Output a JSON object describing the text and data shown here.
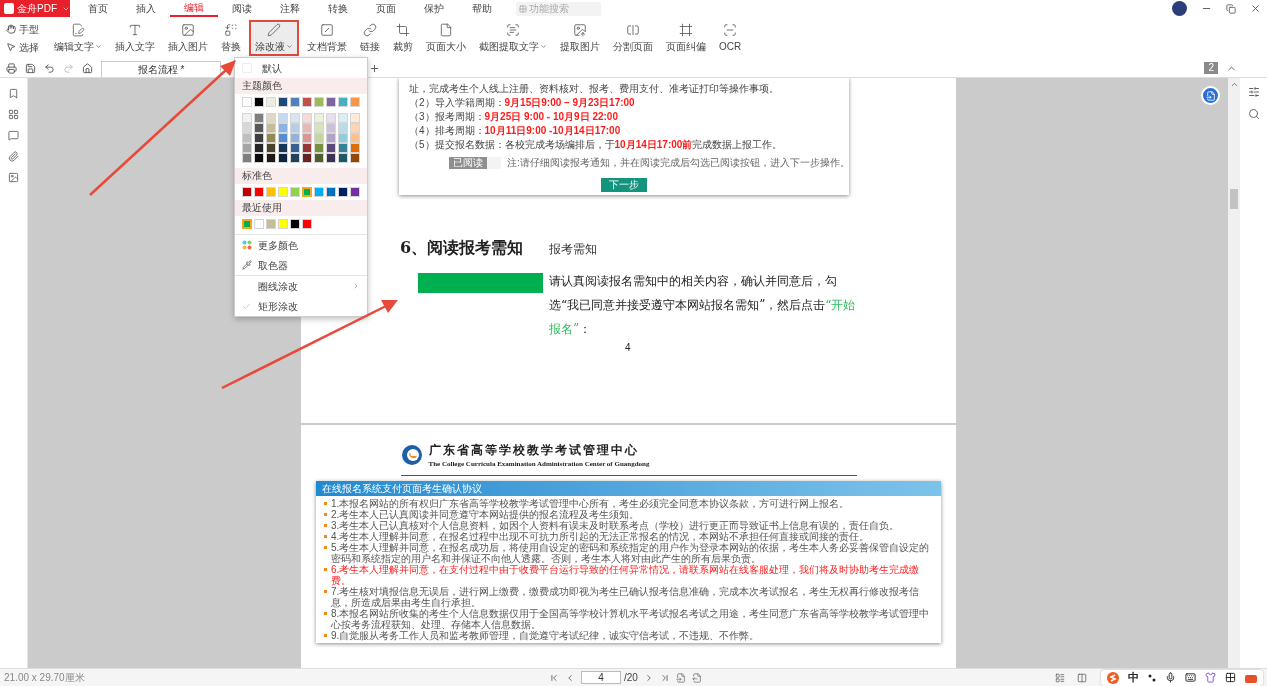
{
  "app": {
    "logo": "金舟PDF",
    "search": {
      "placeholder": "功能搜索"
    }
  },
  "menu": {
    "tabs": [
      {
        "label": "首页",
        "selected": false
      },
      {
        "label": "插入",
        "selected": false
      },
      {
        "label": "编辑",
        "selected": true
      },
      {
        "label": "阅读",
        "selected": false
      },
      {
        "label": "注释",
        "selected": false
      },
      {
        "label": "转换",
        "selected": false
      },
      {
        "label": "页面",
        "selected": false
      },
      {
        "label": "保护",
        "selected": false
      },
      {
        "label": "帮助",
        "selected": false
      }
    ]
  },
  "ribbon": {
    "modes": [
      {
        "label": "手型"
      },
      {
        "label": "选择"
      }
    ],
    "tools": [
      {
        "label": "编辑文字",
        "dropdown": true,
        "selected": false
      },
      {
        "label": "插入文字",
        "dropdown": false,
        "selected": false
      },
      {
        "label": "插入图片",
        "dropdown": false,
        "selected": false
      },
      {
        "label": "替换",
        "dropdown": false,
        "selected": false
      },
      {
        "label": "涂改液",
        "dropdown": true,
        "selected": true
      },
      {
        "label": "文档背景",
        "dropdown": false,
        "selected": false
      },
      {
        "label": "链接",
        "dropdown": false,
        "selected": false
      },
      {
        "label": "裁剪",
        "dropdown": false,
        "selected": false
      },
      {
        "label": "页面大小",
        "dropdown": false,
        "selected": false
      },
      {
        "label": "截图提取文字",
        "dropdown": true,
        "selected": false
      },
      {
        "label": "提取图片",
        "dropdown": false,
        "selected": false
      },
      {
        "label": "分割页面",
        "dropdown": false,
        "selected": false
      },
      {
        "label": "页面纠偏",
        "dropdown": false,
        "selected": false
      },
      {
        "label": "OCR",
        "dropdown": false,
        "selected": false
      }
    ]
  },
  "doc_tabs": [
    {
      "label": "报名流程 *",
      "selected": true
    }
  ],
  "page_badge": "2",
  "page1": {
    "notice": {
      "lines": [
        {
          "segments": [
            {
              "text": "址，完成考生个人线上注册、资料核对、报考、费用支付、准考证打印等操作事项。",
              "emphasis": false
            }
          ]
        },
        {
          "segments": [
            {
              "text": "（2）导入学籍周期：",
              "emphasis": false
            },
            {
              "text": "9月15日9:00 – 9月23日17:00",
              "emphasis": true
            }
          ]
        },
        {
          "segments": [
            {
              "text": "（3）报考周期：",
              "emphasis": false
            },
            {
              "text": "9月25日 9:00 - 10月9日 22:00",
              "emphasis": true
            }
          ]
        },
        {
          "segments": [
            {
              "text": "（4）排考周期：",
              "emphasis": false
            },
            {
              "text": "10月11日9:00 -10月14日17:00",
              "emphasis": true
            }
          ]
        },
        {
          "segments": [
            {
              "text": "（5）提交报名数据：各校完成考场编排后，于",
              "emphasis": false
            },
            {
              "text": "10月14日17:00前",
              "emphasis": true
            },
            {
              "text": "完成数据上报工作。",
              "emphasis": false
            }
          ]
        }
      ],
      "read_toggle": "已阅读",
      "note": "注:请仔细阅读报考通知，并在阅读完成后勾选已阅读按钮，进入下一步操作。",
      "next_button": "下一步"
    },
    "heading": "6、阅读报考需知",
    "heading_aside": "报考需知",
    "paragraph": [
      {
        "text": "请认真阅读报名需知中的相关内容，确认并同意后，勾选“我已同意并接受遵守本网站报名需知”，然后点击",
        "emphasis": false
      },
      {
        "text": "“开始报名”",
        "emphasis": true
      },
      {
        "text": "：",
        "emphasis": false
      }
    ],
    "page_number": "4"
  },
  "page2": {
    "org_name": "广东省高等学校教学考试管理中心",
    "org_name_en": "The College Curricula Examination Administration Center of Guangdong",
    "panel_title": "在线报名系统支付页面考生确认协议",
    "items": [
      {
        "text": "1.本报名网站的所有权归广东省高等学校教学考试管理中心所有，考生必须完全同意本协议条款，方可进行网上报名。",
        "emphasis": false
      },
      {
        "text": "2.考生本人已认真阅读并同意遵守本网站提供的报名流程及考生须知。",
        "emphasis": false
      },
      {
        "text": "3.考生本人已认真核对个人信息资料，如因个人资料有误未及时联系考点（学校）进行更正而导致证书上信息有误的，责任自负。",
        "emphasis": false
      },
      {
        "text": "4.考生本人理解并同意，在报名过程中出现不可抗力所引起的无法正常报名的情况，本网站不承担任何直接或间接的责任。",
        "emphasis": false
      },
      {
        "text": "5.考生本人理解并同意，在报名成功后，将使用自设定的密码和系统指定的用户作为登录本网站的依据，考生本人务必妥善保管自设定的密码和系统指定的用户名和并保证不向他人透露。否则，考生本人将对由此产生的所有后果负责。",
        "emphasis": false
      },
      {
        "text": "6.考生本人理解并同意，在支付过程中由于收费平台运行导致的任何异常情况，请联系网站在线客服处理，我们将及时协助考生完成缴费。",
        "emphasis": true
      },
      {
        "text": "7.考生核对填报信息无误后，进行网上缴费，缴费成功即视为考生已确认报考信息准确，完成本次考试报名，考生无权再行修改报考信息，所造成后果由考生自行承担。",
        "emphasis": false
      },
      {
        "text": "8.本报名网站所收集的考生个人信息数据仅用于全国高等学校计算机水平考试报名考试之用途，考生同意广东省高等学校教学考试管理中心按考务流程获知、处理、存储本人信息数据。",
        "emphasis": false
      },
      {
        "text": "9.自觉服从考务工作人员和监考教师管理，自觉遵守考试纪律，诚实守信考试，不违规、不作弊。",
        "emphasis": false
      }
    ]
  },
  "color_menu": {
    "default_label": "默认",
    "theme_title": "主题颜色",
    "theme_colors": [
      {
        "color": "#ffffff",
        "selected": false
      },
      {
        "color": "#000000",
        "selected": false
      },
      {
        "color": "#eeece1",
        "selected": false
      },
      {
        "color": "#1f497d",
        "selected": false
      },
      {
        "color": "#4f81bd",
        "selected": false
      },
      {
        "color": "#c0504d",
        "selected": false
      },
      {
        "color": "#9bbb59",
        "selected": false
      },
      {
        "color": "#8064a2",
        "selected": false
      },
      {
        "color": "#4bacc6",
        "selected": false
      },
      {
        "color": "#f79646",
        "selected": false
      }
    ],
    "theme_shades": [
      {
        "color": "#f2f2f2",
        "selected": false
      },
      {
        "color": "#7f7f7f",
        "selected": false
      },
      {
        "color": "#ddd9c3",
        "selected": false
      },
      {
        "color": "#c6d9f0",
        "selected": false
      },
      {
        "color": "#dbe5f1",
        "selected": false
      },
      {
        "color": "#f2dcdb",
        "selected": false
      },
      {
        "color": "#ebf1dd",
        "selected": false
      },
      {
        "color": "#e5e0ec",
        "selected": false
      },
      {
        "color": "#dbeef3",
        "selected": false
      },
      {
        "color": "#fdeada",
        "selected": false
      },
      {
        "color": "#d8d8d8",
        "selected": false
      },
      {
        "color": "#595959",
        "selected": false
      },
      {
        "color": "#c4bd97",
        "selected": false
      },
      {
        "color": "#8db3e2",
        "selected": false
      },
      {
        "color": "#b8cce4",
        "selected": false
      },
      {
        "color": "#e5b9b7",
        "selected": false
      },
      {
        "color": "#d7e3bc",
        "selected": false
      },
      {
        "color": "#ccc1d9",
        "selected": false
      },
      {
        "color": "#b7dde8",
        "selected": false
      },
      {
        "color": "#fbd5b5",
        "selected": false
      },
      {
        "color": "#bfbfbf",
        "selected": false
      },
      {
        "color": "#3f3f3f",
        "selected": false
      },
      {
        "color": "#938953",
        "selected": false
      },
      {
        "color": "#548dd4",
        "selected": false
      },
      {
        "color": "#95b3d7",
        "selected": false
      },
      {
        "color": "#d99694",
        "selected": false
      },
      {
        "color": "#c3d69b",
        "selected": false
      },
      {
        "color": "#b2a2c7",
        "selected": false
      },
      {
        "color": "#92cddc",
        "selected": false
      },
      {
        "color": "#fac08f",
        "selected": false
      },
      {
        "color": "#a5a5a5",
        "selected": false
      },
      {
        "color": "#262626",
        "selected": false
      },
      {
        "color": "#494429",
        "selected": false
      },
      {
        "color": "#17365d",
        "selected": false
      },
      {
        "color": "#366092",
        "selected": false
      },
      {
        "color": "#953734",
        "selected": false
      },
      {
        "color": "#76923c",
        "selected": false
      },
      {
        "color": "#5f497a",
        "selected": false
      },
      {
        "color": "#31859b",
        "selected": false
      },
      {
        "color": "#e36c09",
        "selected": false
      },
      {
        "color": "#7f7f7f",
        "selected": false
      },
      {
        "color": "#0c0c0c",
        "selected": false
      },
      {
        "color": "#1d1b10",
        "selected": false
      },
      {
        "color": "#0f243e",
        "selected": false
      },
      {
        "color": "#244061",
        "selected": false
      },
      {
        "color": "#632423",
        "selected": false
      },
      {
        "color": "#4f6128",
        "selected": false
      },
      {
        "color": "#3f3151",
        "selected": false
      },
      {
        "color": "#205867",
        "selected": false
      },
      {
        "color": "#974806",
        "selected": false
      }
    ],
    "standard_title": "标准色",
    "standard_colors": [
      {
        "color": "#c00000",
        "selected": false
      },
      {
        "color": "#ff0000",
        "selected": false
      },
      {
        "color": "#ffc000",
        "selected": false
      },
      {
        "color": "#ffff00",
        "selected": false
      },
      {
        "color": "#92d050",
        "selected": false
      },
      {
        "color": "#00b050",
        "selected": true
      },
      {
        "color": "#00b0f0",
        "selected": false
      },
      {
        "color": "#0070c0",
        "selected": false
      },
      {
        "color": "#002060",
        "selected": false
      },
      {
        "color": "#7030a0",
        "selected": false
      }
    ],
    "recent_title": "最近使用",
    "recent_colors": [
      {
        "color": "#00b050",
        "selected": true
      },
      {
        "color": "#ffffff",
        "selected": false
      },
      {
        "color": "#c4bd97",
        "selected": false
      },
      {
        "color": "#ffff00",
        "selected": false
      },
      {
        "color": "#000000",
        "selected": false
      },
      {
        "color": "#ff0000",
        "selected": false
      }
    ],
    "actions": [
      {
        "label": "更多颜色"
      },
      {
        "label": "取色器"
      }
    ],
    "modes": [
      {
        "label": "圈线涂改",
        "checked": false,
        "submenu": true
      },
      {
        "label": "矩形涂改",
        "checked": true,
        "submenu": false
      }
    ]
  },
  "status_bar": {
    "dimensions": "21.00 x 29.70厘米",
    "page_input": "4",
    "page_total": "/20",
    "ime_label": "中"
  }
}
